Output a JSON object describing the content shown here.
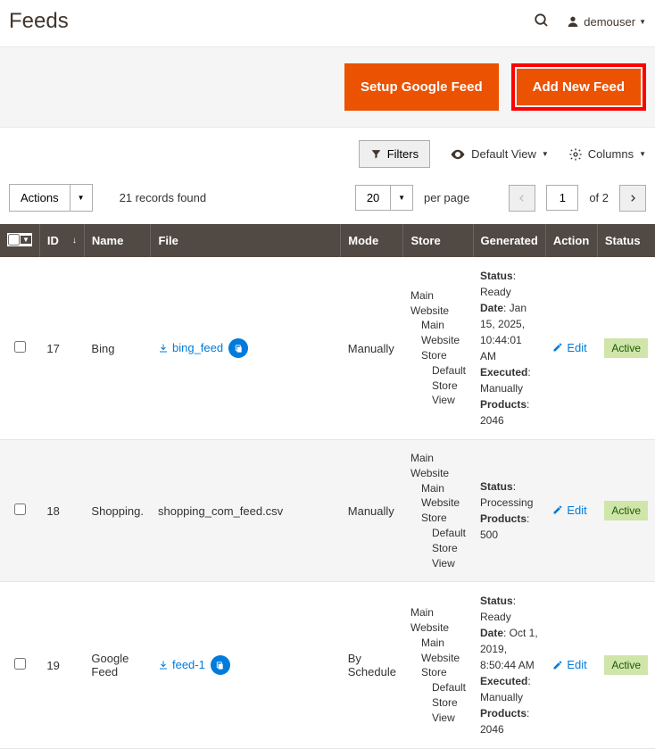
{
  "header": {
    "title": "Feeds",
    "user": "demouser"
  },
  "buttons": {
    "setup_google": "Setup Google Feed",
    "add_new": "Add New Feed"
  },
  "toolbar": {
    "filters": "Filters",
    "default_view": "Default View",
    "columns": "Columns",
    "actions": "Actions",
    "records_found": "21 records found",
    "per_page_value": "20",
    "per_page_label": "per page",
    "page_value": "1",
    "page_of": "of 2"
  },
  "columns": {
    "id": "ID",
    "name": "Name",
    "file": "File",
    "mode": "Mode",
    "store": "Store",
    "generated": "Generated",
    "action": "Action",
    "status": "Status"
  },
  "store_default": {
    "l1": "Main Website",
    "l2": "Main Website Store",
    "l3": "Default Store View"
  },
  "labels": {
    "status": "Status",
    "date": "Date",
    "executed": "Executed",
    "products": "Products",
    "edit": "Edit"
  },
  "rows": [
    {
      "id": "17",
      "name": "Bing",
      "file_name": "bing_feed",
      "file_link": true,
      "mode": "Manually",
      "gen": {
        "status": "Ready",
        "date": "Jan 15, 2025, 10:44:01 AM",
        "executed": "Manually",
        "products": "2046"
      },
      "status": "Active"
    },
    {
      "id": "18",
      "name": "Shopping.",
      "file_name": "shopping_com_feed.csv",
      "file_link": false,
      "mode": "Manually",
      "gen": {
        "status": "Processing",
        "products": "500"
      },
      "status": "Active"
    },
    {
      "id": "19",
      "name": "Google Feed",
      "file_name": "feed-1",
      "file_link": true,
      "mode": "By Schedule",
      "gen": {
        "status": "Ready",
        "date": "Oct 1, 2019, 8:50:44 AM",
        "executed": "Manually",
        "products": "2046"
      },
      "status": "Active"
    }
  ]
}
